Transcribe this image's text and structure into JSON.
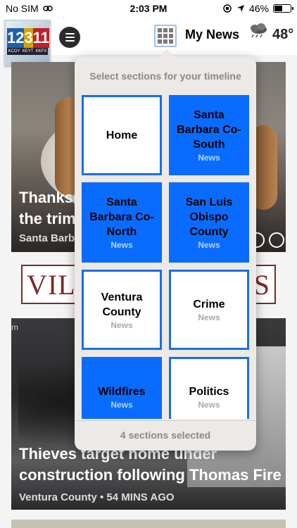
{
  "status_bar": {
    "carrier": "No SIM",
    "time": "2:03 PM",
    "battery": "46%",
    "battery_level": 0.46
  },
  "header": {
    "logo_numbers": [
      "12",
      "3",
      "11"
    ],
    "logo_calls": [
      "KCOY",
      "KEYT",
      "KKFX"
    ],
    "title": "My News",
    "temperature": "48°",
    "icons": [
      "menu-icon",
      "grid-icon",
      "weather-cloud-icon"
    ]
  },
  "feed": {
    "card1": {
      "title_line1": "Thanksg",
      "title_line2": "the trim",
      "meta": "Santa Barb"
    },
    "ad": {
      "left_text": "VILL",
      "right_text": "S"
    },
    "card2": {
      "corner": "m",
      "title_line1": "Thieves target home under",
      "title_line2": "construction following Thomas Fire",
      "meta": "Ventura County • 54 MINS AGO"
    }
  },
  "popup": {
    "heading": "Select sections for your timeline",
    "footer": "4 sections selected",
    "sections": [
      {
        "title": "Home",
        "subtitle": "",
        "selected": false
      },
      {
        "title": "Santa Barbara Co-South",
        "subtitle": "News",
        "selected": true
      },
      {
        "title": "Santa Barbara Co-North",
        "subtitle": "News",
        "selected": true
      },
      {
        "title": "San Luis Obispo County",
        "subtitle": "News",
        "selected": true
      },
      {
        "title": "Ventura County",
        "subtitle": "News",
        "selected": false
      },
      {
        "title": "Crime",
        "subtitle": "News",
        "selected": false
      },
      {
        "title": "Wildfires",
        "subtitle": "News",
        "selected": true
      },
      {
        "title": "Politics",
        "subtitle": "News",
        "selected": false
      }
    ]
  },
  "colors": {
    "selected_tile": "#0a6cff",
    "tile_border": "#1a6fe6",
    "popup_bg": "#ece9e6"
  }
}
